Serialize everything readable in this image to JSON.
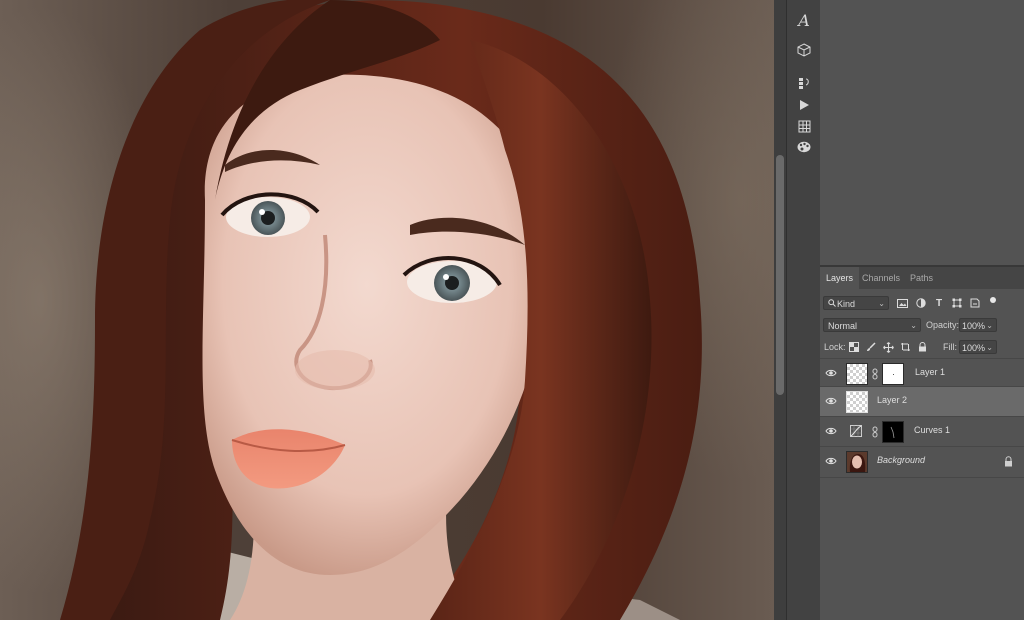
{
  "panel": {
    "tabs": [
      {
        "label": "Layers",
        "active": true
      },
      {
        "label": "Channels",
        "active": false
      },
      {
        "label": "Paths",
        "active": false
      }
    ],
    "filter": {
      "value": "Kind"
    },
    "blend_mode": {
      "value": "Normal"
    },
    "opacity": {
      "label": "Opacity:",
      "value": "100%"
    },
    "lock": {
      "label": "Lock:"
    },
    "fill": {
      "label": "Fill:",
      "value": "100%"
    },
    "layers": [
      {
        "name": "Layer 1",
        "selected": false,
        "has_mask": true,
        "locked": false
      },
      {
        "name": "Layer 2",
        "selected": true,
        "has_mask": false,
        "locked": false
      },
      {
        "name": "Curves 1",
        "selected": false,
        "has_mask": true,
        "adjustment": true,
        "locked": false
      },
      {
        "name": "Background",
        "selected": false,
        "italic": true,
        "locked": true
      }
    ]
  },
  "strip_icons": [
    "glyph-icon",
    "3d-cube-icon",
    "timeline-icon",
    "play-icon",
    "grid-icon",
    "palette-icon"
  ],
  "colors": {
    "panel_bg": "#535353",
    "selected_layer": "#6a6a6a",
    "dark_border": "#383838"
  }
}
